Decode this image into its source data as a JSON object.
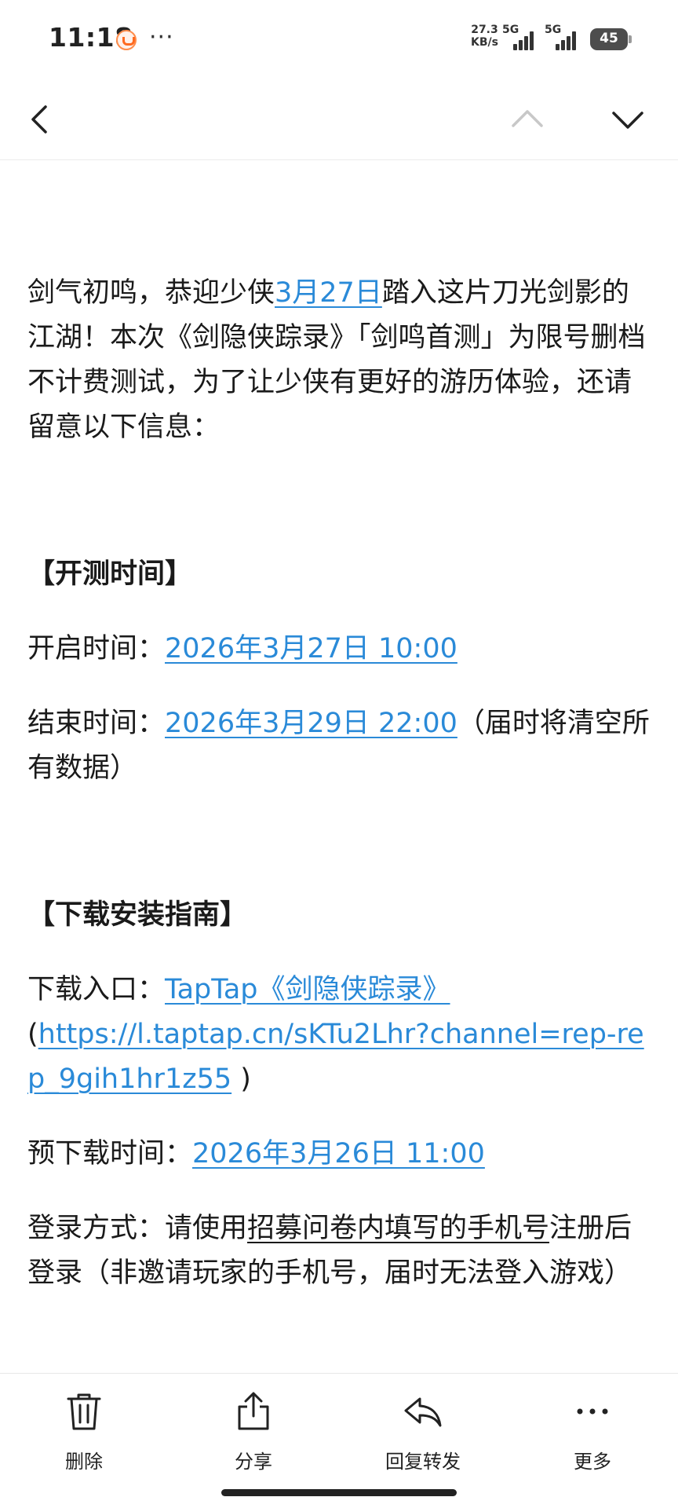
{
  "status_bar": {
    "time": "11:18",
    "more": "···",
    "net_speed_value": "27.3",
    "net_speed_unit": "KB/s",
    "sim1_label": "5G",
    "sim2_label": "5G",
    "battery": "45",
    "icons": [
      "app-notification-icon",
      "signal-icon",
      "battery-icon"
    ]
  },
  "nav": {
    "icons": [
      "back-arrow-icon",
      "chevron-up-icon",
      "chevron-down-icon"
    ]
  },
  "email": {
    "intro_before": "剑气初鸣，恭迎少侠",
    "intro_date": "3月27日",
    "intro_after": "踏入这片刀光剑影的江湖！本次《剑隐侠踪录》「剑鸣首测」为限号删档不计费测试，为了让少侠有更好的游历体验，还请留意以下信息：",
    "section_time_title": "【开测时间】",
    "start_label": "开启时间：",
    "start_value": "2026年3月27日 10:00",
    "end_label": "结束时间：",
    "end_value": "2026年3月29日 22:00",
    "end_note": "（届时将清空所有数据）",
    "section_download_title": "【下载安装指南】",
    "download_label": "下载入口：",
    "download_link": "TapTap《剑隐侠踪录》",
    "download_url_open": "(",
    "download_url": "https://l.taptap.cn/sKTu2Lhr?channel=rep-rep_9gih1hr1z55",
    "download_url_close": " )",
    "predownload_label": "预下载时间：",
    "predownload_value": "2026年3月26日 11:00",
    "login_label": "登录方式：请使用",
    "login_underlined": "招募问卷内填写的手机号",
    "login_after": "注册后登录（非邀请玩家的手机号，届时无法登入游戏）"
  },
  "toolbar": {
    "delete": "删除",
    "share": "分享",
    "reply_forward": "回复转发",
    "more": "更多"
  },
  "colors": {
    "link": "#2a8ad8",
    "text": "#1a1a1a",
    "nav_disabled": "#c8c8c8"
  }
}
